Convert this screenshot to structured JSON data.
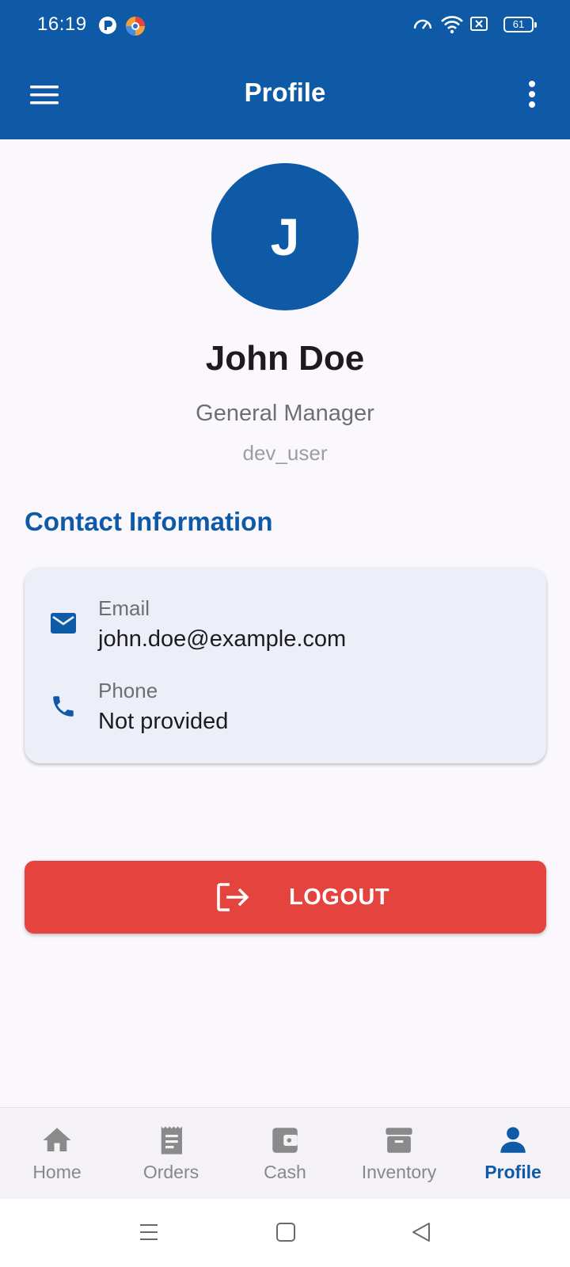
{
  "status_bar": {
    "time": "16:19",
    "battery": "61"
  },
  "app_bar": {
    "title": "Profile"
  },
  "profile": {
    "avatar_initial": "J",
    "name": "John Doe",
    "role": "General Manager",
    "username": "dev_user"
  },
  "contact": {
    "section_title": "Contact Information",
    "email_label": "Email",
    "email_value": "john.doe@example.com",
    "phone_label": "Phone",
    "phone_value": "Not provided"
  },
  "logout": {
    "label": "LOGOUT"
  },
  "bottom_nav": {
    "items": [
      {
        "label": "Home",
        "icon": "home-icon"
      },
      {
        "label": "Orders",
        "icon": "receipt-icon"
      },
      {
        "label": "Cash",
        "icon": "wallet-icon"
      },
      {
        "label": "Inventory",
        "icon": "archive-box-icon"
      },
      {
        "label": "Profile",
        "icon": "person-icon"
      }
    ],
    "active_index": 4
  },
  "colors": {
    "primary": "#0e5aa7",
    "danger": "#e4443d",
    "background": "#fbf8fd",
    "card": "#eceff8"
  }
}
